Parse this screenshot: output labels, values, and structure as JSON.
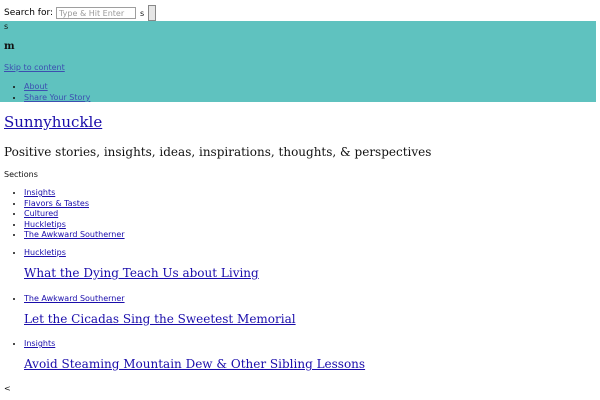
{
  "search": {
    "label": "Search for:",
    "placeholder": "Type & Hit Enter",
    "submit_label": "s"
  },
  "header": {
    "icon_s": "s",
    "icon_m": "m",
    "skip_link": "Skip to content"
  },
  "top_nav": [
    {
      "label": "About"
    },
    {
      "label": "Share Your Story"
    }
  ],
  "site": {
    "title": "Sunnyhuckle",
    "tagline": "Positive stories, insights, ideas, inspirations, thoughts, & perspectives"
  },
  "sections": {
    "label": "Sections",
    "items": [
      "Insights",
      "Flavors & Tastes",
      "Cultured",
      "Huckletips",
      "The Awkward Southerner"
    ]
  },
  "articles": [
    {
      "category": "Huckletips",
      "title": "What the Dying Teach Us about Living"
    },
    {
      "category": "The Awkward Southerner",
      "title": "Let the Cicadas Sing the Sweetest Memorial"
    },
    {
      "category": "Insights",
      "title": "Avoid Steaming Mountain Dew & Other Sibling Lessons"
    }
  ],
  "pager": {
    "prev": "<"
  },
  "colors": {
    "banner": "#5fc2bf",
    "link": "#1a0dab"
  }
}
